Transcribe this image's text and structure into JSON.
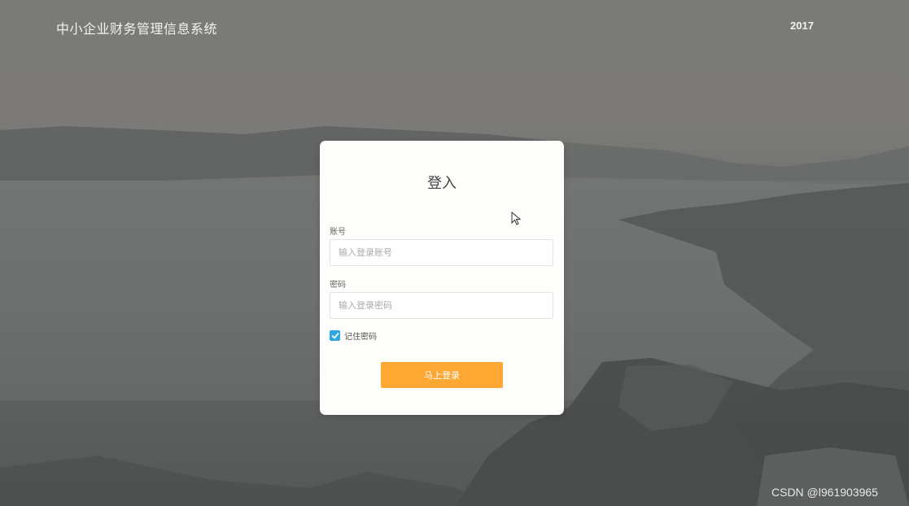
{
  "header": {
    "title": "中小企业财务管理信息系统",
    "year": "2017"
  },
  "login": {
    "title": "登入",
    "account_label": "账号",
    "account_placeholder": "输入登录账号",
    "account_value": "",
    "password_label": "密码",
    "password_placeholder": "输入登录密码",
    "password_value": "",
    "remember_label": "记住密码",
    "remember_checked": true,
    "submit_label": "马上登录"
  },
  "watermark": "CSDN @l961903965",
  "colors": {
    "accent_button": "#ffa733",
    "checkbox": "#2ea7e0",
    "card_bg": "#fdfdfb"
  },
  "icons": {
    "checkbox": "check-icon",
    "pointer": "mouse-cursor-icon"
  }
}
